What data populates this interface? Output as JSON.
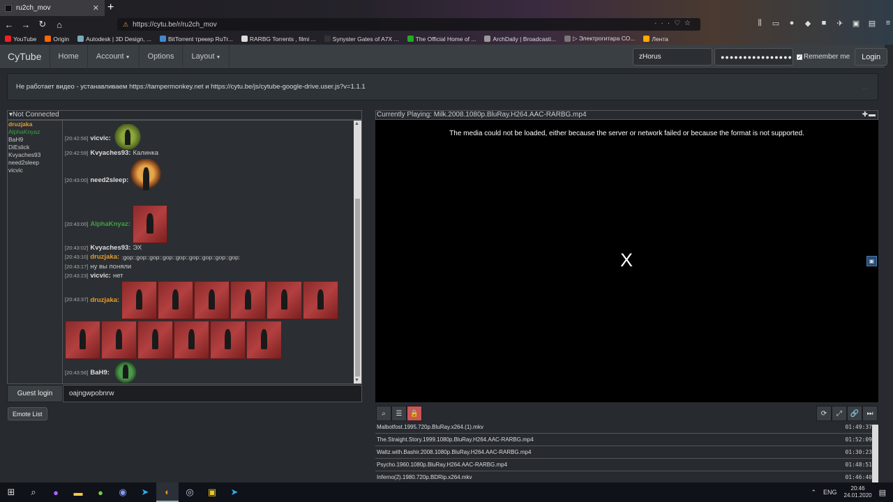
{
  "browser": {
    "tab_title": "ru2ch_mov",
    "url": "https://cytu.be/r/ru2ch_mov",
    "bookmarks": [
      {
        "label": "YouTube",
        "color": "#e22"
      },
      {
        "label": "Origin",
        "color": "#f60"
      },
      {
        "label": "Autodesk | 3D Design, ...",
        "color": "#7ab"
      },
      {
        "label": "BitTorrent трекер RuTr...",
        "color": "#48c"
      },
      {
        "label": "RARBG Torrents , filmi ...",
        "color": "#ddd"
      },
      {
        "label": "Synyster Gates of A7X ...",
        "color": "#333"
      },
      {
        "label": "The Official Home of ...",
        "color": "#2a2"
      },
      {
        "label": "ArchDaily | Broadcasti...",
        "color": "#999"
      },
      {
        "label": "▷ Электрогитара СО...",
        "color": "#777"
      },
      {
        "label": "Лента",
        "color": "#fa0"
      }
    ]
  },
  "navbar": {
    "brand": "CyTube",
    "links": [
      "Home",
      "Account",
      "Options",
      "Layout"
    ]
  },
  "login": {
    "username": "zHorus",
    "password_mask": "●●●●●●●●●●●●●●●●",
    "remember_label": "Remember me",
    "button": "Login"
  },
  "motd": "Не работает видео - устанавливаем https://tampermonkey.net и https://cytu.be/js/cytube-google-drive.user.js?v=1.1.1",
  "motd_dots": "...",
  "chat": {
    "header": "Not Connected",
    "users": [
      {
        "name": "druzjaka",
        "color": "#e89c28",
        "bold": true
      },
      {
        "name": "AlphaKnyaz",
        "color": "#3ea33e",
        "bold": false
      },
      {
        "name": "ВаН9",
        "color": "#ccc",
        "bold": false
      },
      {
        "name": "DiEslick",
        "color": "#ccc",
        "bold": false
      },
      {
        "name": "Kvyaches93",
        "color": "#ccc",
        "bold": false
      },
      {
        "name": "need2sleep",
        "color": "#ccc",
        "bold": false
      },
      {
        "name": "vicvic",
        "color": "#ccc",
        "bold": false
      }
    ],
    "messages": [
      {
        "ts": "[20:42:56]",
        "name": "vicvic:",
        "text": ""
      },
      {
        "ts": "[20:42:59]",
        "name": "Kvyaches93:",
        "text": "Калинка"
      },
      {
        "ts": "[20:43:00]",
        "name": "need2sleep:",
        "text": ""
      },
      {
        "ts": "[20:43:00]",
        "name": "AlphaKnyaz:",
        "text": ""
      },
      {
        "ts": "[20:43:02]",
        "name": "Kvyaches93:",
        "text": "ЭХ"
      },
      {
        "ts": "[20:43:10]",
        "name": "druzjaka:",
        "text": ":gop::gop::gop::gop::gop::gop::gop::gop::gop:"
      },
      {
        "ts": "[20:43:17]",
        "name": "",
        "text": "ну вы поняли"
      },
      {
        "ts": "[20:43:23]",
        "name": "vicvic:",
        "text": "нет"
      },
      {
        "ts": "[20:43:37]",
        "name": "druzjaka:",
        "text": ""
      },
      {
        "ts": "[20:43:56]",
        "name": "ВаН9:",
        "text": ""
      }
    ],
    "guest_login": "Guest login",
    "input_value": "oajngwpobnrw",
    "emote_list": "Emote List"
  },
  "player": {
    "currently_playing": "Currently Playing: Milk.2008.1080p.BluRay.H264.AAC-RARBG.mp4",
    "error": "The media could not be loaded, either because the server or network failed or because the format is not supported.",
    "close_glyph": "X"
  },
  "playlist": [
    {
      "title": "Malbotfost.1995.720p.BluRay.x264.(1).mkv",
      "duration": "01:49:37"
    },
    {
      "title": "The.Straight.Story.1999.1080p.BluRay.H264.AAC-RARBG.mp4",
      "duration": "01:52:09"
    },
    {
      "title": "Waltz.with.Bashir.2008.1080p.BluRay.H264.AAC-RARBG.mp4",
      "duration": "01:30:23"
    },
    {
      "title": "Psycho.1960.1080p.BluRay.H264.AAC-RARBG.mp4",
      "duration": "01:48:51"
    },
    {
      "title": "Inferno(2).1980.720p.BDRip.x264.mkv",
      "duration": "01:46:40"
    }
  ],
  "taskbar": {
    "lang": "ENG",
    "time": "20:46",
    "date": "24.01.2020"
  }
}
